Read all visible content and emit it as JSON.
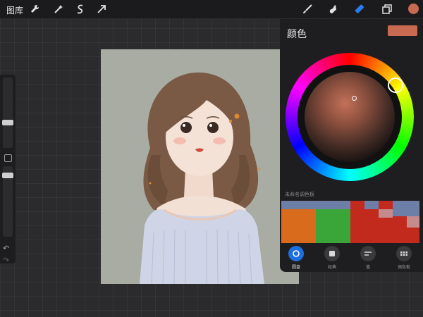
{
  "topbar": {
    "gallery_label": "图库",
    "tools_left": [
      "wrench-icon",
      "magic-wand-icon",
      "selection-icon",
      "transform-arrow-icon"
    ],
    "tools_right": [
      "brush-icon",
      "smudge-icon",
      "eraser-icon",
      "layers-icon"
    ],
    "active_tool": "eraser-icon",
    "current_color": "#c86a52"
  },
  "color_panel": {
    "title": "颜色",
    "current_color": "#c86a52",
    "palette_name": "未命名调色板",
    "palette_cells": [
      "#6d7fa6",
      "#6d7fa6",
      "#c22a1e",
      "#6d7fa6",
      "#c22a1e",
      "#6d7fa6",
      "#c22a1e",
      "#c58a8c",
      "#d96b1c",
      "#3aa63a",
      "#c22a1e",
      "#c22a1e",
      "#c22a1e",
      "#c58a8c"
    ],
    "tabs": [
      {
        "label": "圆盘",
        "icon": "disc-icon",
        "active": true
      },
      {
        "label": "经典",
        "icon": "square-icon",
        "active": false
      },
      {
        "label": "值",
        "icon": "sliders-icon",
        "active": false
      },
      {
        "label": "调色板",
        "icon": "grid-icon",
        "active": false
      }
    ]
  }
}
